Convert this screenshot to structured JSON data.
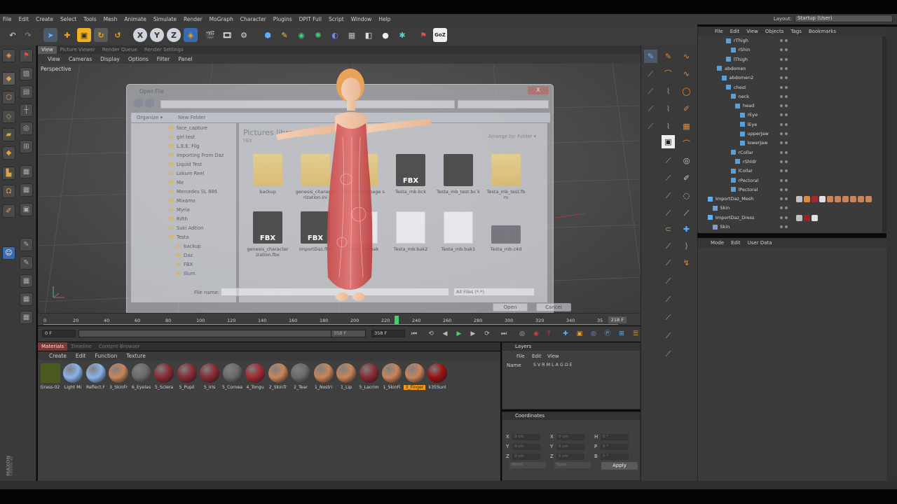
{
  "menubar": {
    "items": [
      "File",
      "Edit",
      "Create",
      "Select",
      "Tools",
      "Mesh",
      "Animate",
      "Simulate",
      "Render",
      "MoGraph",
      "Character",
      "Plugins",
      "DPIT Full",
      "Script",
      "Window",
      "Help"
    ],
    "layout_label": "Layout:",
    "layout_value": "Startup (User)"
  },
  "toolbar": {
    "axis_x": "X",
    "axis_y": "Y",
    "axis_z": "Z",
    "goz": "GoZ"
  },
  "viewport": {
    "tabs": [
      "View",
      "Picture Viewer",
      "Render Queue",
      "Render Settings"
    ],
    "menu": [
      "View",
      "Cameras",
      "Display",
      "Options",
      "Filter",
      "Panel"
    ],
    "label": "Perspective"
  },
  "dialog": {
    "title": "Open File",
    "close": "X",
    "organize": "Organize ▾",
    "new_folder": "New Folder",
    "nav_items": [
      "face_capture",
      "girl test",
      "L.E.E. Filg",
      "Importing From Daz",
      "Liquid Test",
      "Lokum Reel",
      "Me",
      "Mercedes SL 886",
      "Mixamo",
      "Myria",
      "Rifth",
      "Suki Adtion",
      "Testa",
      "backup",
      "Daz",
      "FBX",
      "Illum"
    ],
    "library_title": "Pictures library",
    "library_sub": "FBX",
    "arrange_label": "Arrange by:",
    "arrange_value": "Folder ▾",
    "files": [
      {
        "name": "backup",
        "kind": "folder"
      },
      {
        "name": "genesis_characte rization.ini",
        "kind": "folder"
      },
      {
        "name": "ImportDaz.image s",
        "kind": "folder"
      },
      {
        "name": "Testa_mb.bck",
        "kind": "fbx"
      },
      {
        "name": "Testa_mb_test.bc k",
        "kind": "fbx"
      },
      {
        "name": "Testa_mb_test.fb m",
        "kind": "folder"
      },
      {
        "name": "genesis_character ization.fbx",
        "kind": "fbx"
      },
      {
        "name": "ImportDaz.fbx",
        "kind": "fbx"
      },
      {
        "name": "Testa_mb.bak",
        "kind": "doc"
      },
      {
        "name": "Testa_mb.bak2",
        "kind": "doc"
      },
      {
        "name": "Testa_mb.bak1",
        "kind": "doc"
      },
      {
        "name": "Testa_mb.c4d",
        "kind": "c4d"
      }
    ],
    "fbx_text": "FBX",
    "filename_label": "File name:",
    "filename_value": "",
    "filter_value": "All Files (*.*)",
    "open_button": "Open",
    "cancel_button": "Cancel"
  },
  "timeline": {
    "ticks": [
      "0",
      "20",
      "40",
      "60",
      "80",
      "100",
      "120",
      "140",
      "160",
      "180",
      "200",
      "220",
      "240",
      "260",
      "280",
      "300",
      "320",
      "340",
      "35"
    ],
    "playhead_frame": 220,
    "end_frame": "218 F",
    "current_frame": "0 F",
    "min_frame": "0 F",
    "max_frame": "358 F",
    "range_end": "358 F"
  },
  "materials": {
    "tabs": [
      "Materials",
      "Timeline",
      "Content Browser"
    ],
    "menu": [
      "Create",
      "Edit",
      "Function",
      "Texture"
    ],
    "items": [
      {
        "name": "Grass-02",
        "color": "#4a5a1f"
      },
      {
        "name": "Light Mi",
        "color": "#8ab4e8"
      },
      {
        "name": "Reflect.F",
        "color": "#8ab4e8"
      },
      {
        "name": "3_SkinFr",
        "color": "#c8855a"
      },
      {
        "name": "6_Eyelas",
        "color": "#6a6a6a"
      },
      {
        "name": "5_Sclera",
        "color": "#8a2a34"
      },
      {
        "name": "5_Pupil",
        "color": "#8a2a34"
      },
      {
        "name": "5_Iris",
        "color": "#8a2a34"
      },
      {
        "name": "5_Cornea",
        "color": "#6a6a6a"
      },
      {
        "name": "4_Tongu",
        "color": "#a02a30"
      },
      {
        "name": "2_SkinTr",
        "color": "#c8855a"
      },
      {
        "name": "2_Tear",
        "color": "#6a6a6a"
      },
      {
        "name": "1_Nostri",
        "color": "#c8855a"
      },
      {
        "name": "1_Lip",
        "color": "#c8855a"
      },
      {
        "name": "5_Lacrim",
        "color": "#8a2a34"
      },
      {
        "name": "1_SkinFi",
        "color": "#c8855a"
      },
      {
        "name": "3_Finger",
        "color": "#c8855a"
      },
      {
        "name": "k35Sunl",
        "color": "#a01010"
      }
    ],
    "selected_index": 16
  },
  "layers": {
    "title": "Layers",
    "menu": [
      "File",
      "Edit",
      "View"
    ],
    "col_name": "Name",
    "col_flags": "S V R M L A G D E"
  },
  "coordinates": {
    "title": "Coordinates",
    "rows": [
      {
        "a": "X",
        "b": "X",
        "c": "H"
      },
      {
        "a": "Y",
        "b": "Y",
        "c": "P"
      },
      {
        "a": "Z",
        "b": "Z",
        "c": "B"
      }
    ],
    "pos_value": "0 cm",
    "rot_value": "0 °",
    "world": "World",
    "scale": "Scale",
    "apply": "Apply"
  },
  "object_manager": {
    "menu": [
      "File",
      "Edit",
      "View",
      "Objects",
      "Tags",
      "Bookmarks"
    ],
    "rows": [
      {
        "label": "rThigh",
        "indent": 4
      },
      {
        "label": "rShin",
        "indent": 5
      },
      {
        "label": "lThigh",
        "indent": 4
      },
      {
        "label": "abdomen",
        "indent": 2
      },
      {
        "label": "abdomen2",
        "indent": 3
      },
      {
        "label": "chest",
        "indent": 4
      },
      {
        "label": "neck",
        "indent": 5
      },
      {
        "label": "head",
        "indent": 6
      },
      {
        "label": "rEye",
        "indent": 7
      },
      {
        "label": "lEye",
        "indent": 7
      },
      {
        "label": "upperJaw",
        "indent": 7
      },
      {
        "label": "lowerJaw",
        "indent": 7
      },
      {
        "label": "rCollar",
        "indent": 5
      },
      {
        "label": "rShldr",
        "indent": 6
      },
      {
        "label": "lCollar",
        "indent": 5
      },
      {
        "label": "rPectoral",
        "indent": 5
      },
      {
        "label": "lPectoral",
        "indent": 5
      },
      {
        "label": "ImportDaz_Mesh",
        "indent": 0
      },
      {
        "label": "Skin",
        "indent": 1
      },
      {
        "label": "ImportDaz_Dress",
        "indent": 0
      },
      {
        "label": "Skin",
        "indent": 1
      }
    ]
  },
  "attributes": {
    "menu": [
      "Mode",
      "Edit",
      "User Data"
    ]
  },
  "branding": {
    "text": "MAXON CINEMA 4D"
  }
}
